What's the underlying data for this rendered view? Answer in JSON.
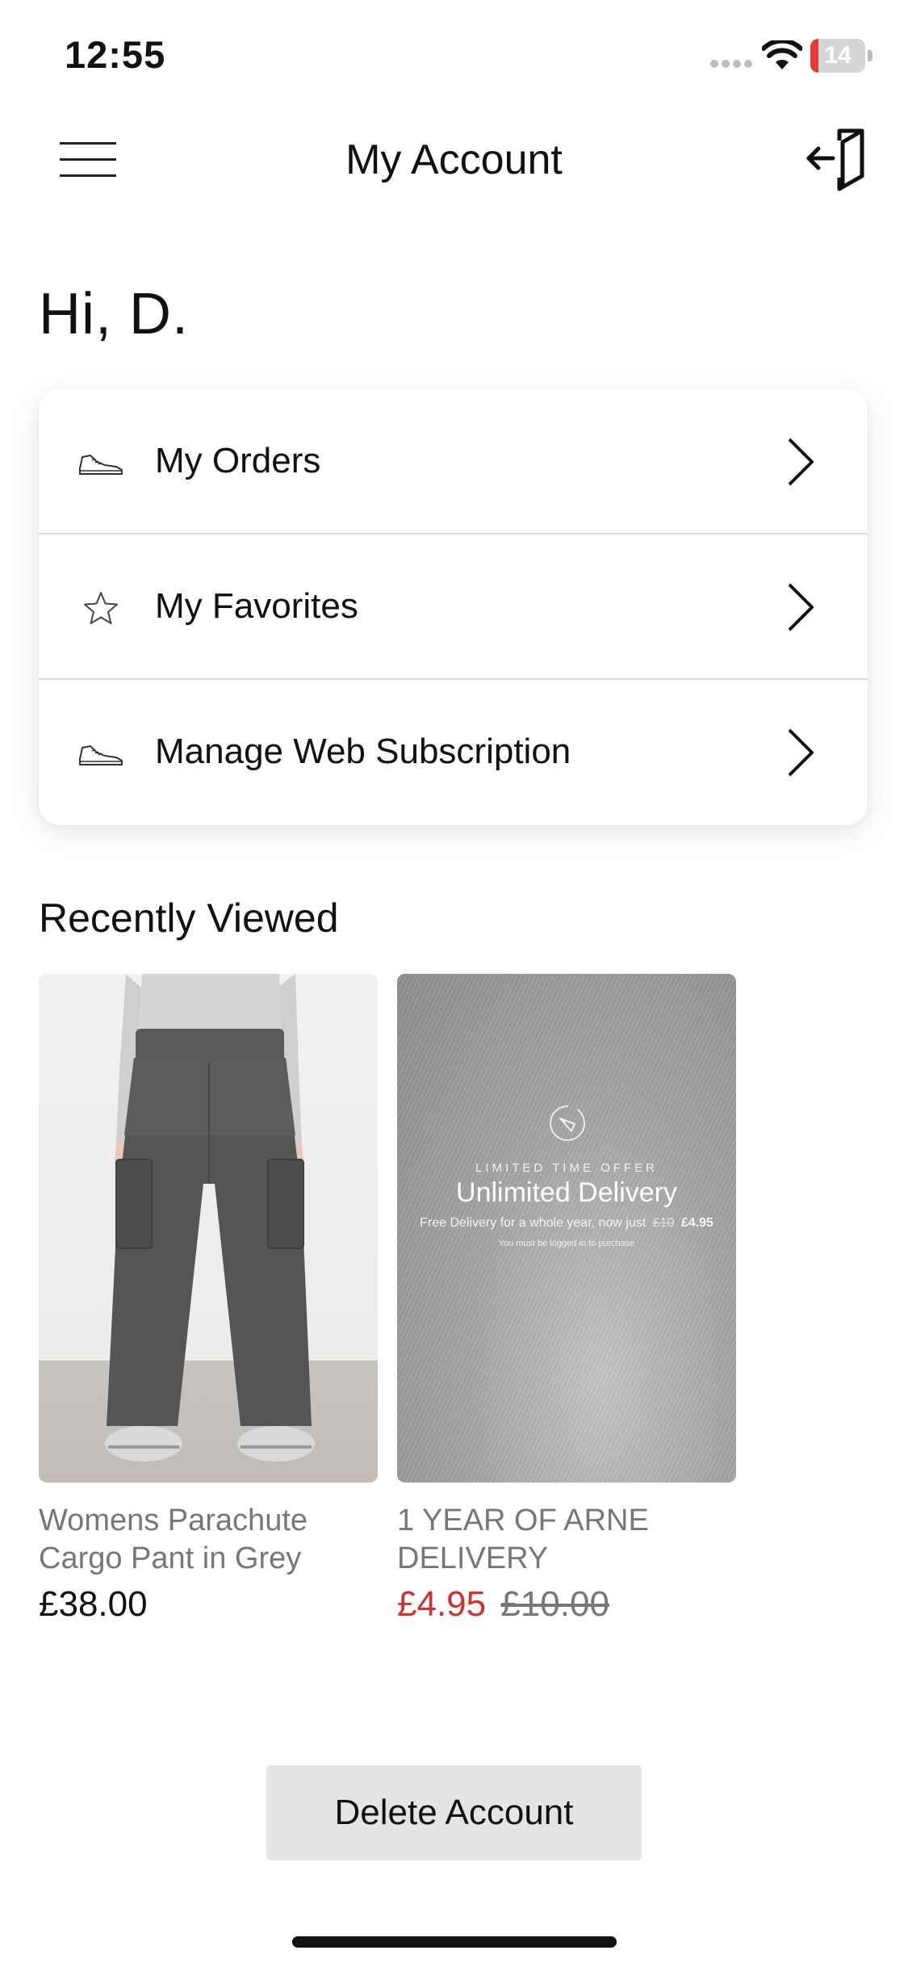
{
  "status_bar": {
    "time": "12:55",
    "battery_level": "14",
    "battery_fraction": 0.14,
    "battery_color": "#e53935",
    "icons": [
      "signal-icon",
      "wifi-icon",
      "battery-icon"
    ]
  },
  "nav": {
    "title": "My Account",
    "left_icon": "hamburger-menu-icon",
    "right_icon": "logout-icon"
  },
  "greeting": "Hi,  D.",
  "menu": [
    {
      "label": "My Orders",
      "icon": "sneaker-icon"
    },
    {
      "label": "My Favorites",
      "icon": "star-icon"
    },
    {
      "label": "Manage Web Subscription",
      "icon": "sneaker-icon"
    }
  ],
  "recently_viewed": {
    "title": "Recently Viewed",
    "products": [
      {
        "name": "Womens Parachute Cargo Pant in Grey",
        "price": "£38.00"
      },
      {
        "name": "1 YEAR OF ARNE DELIVERY",
        "sale_price": "£4.95",
        "original_price": "£10.00",
        "promo": {
          "eyebrow": "LIMITED TIME OFFER",
          "title": "Unlimited Delivery",
          "subtitle_prefix": "Free Delivery for a whole year, now just",
          "old": "£10",
          "new": "£4.95",
          "note": "You must be logged in to purchase"
        }
      }
    ]
  },
  "delete_account_label": "Delete Account",
  "colors": {
    "sale_red": "#d32f2f",
    "text": "#111111",
    "muted": "#777777"
  }
}
